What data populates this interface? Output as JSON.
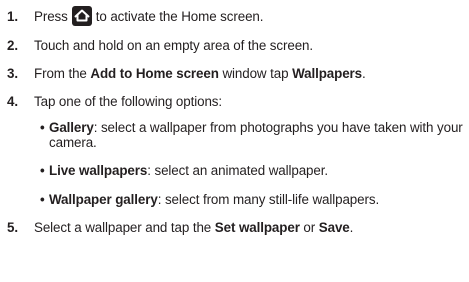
{
  "steps": [
    {
      "number": "1.",
      "before": "Press",
      "icon": "home-key-icon",
      "after": "to activate the Home screen."
    },
    {
      "number": "2.",
      "text": "Touch and hold on an empty area of the screen."
    },
    {
      "number": "3.",
      "pre": "From the ",
      "b1": "Add to Home screen",
      "mid": " window tap ",
      "b2": "Wallpapers",
      "end": "."
    },
    {
      "number": "4.",
      "text": "Tap one of the following options:"
    },
    {
      "number": "5.",
      "pre": "Select a wallpaper and tap the ",
      "b1": "Set wallpaper",
      "mid": " or ",
      "b2": "Save",
      "end": "."
    }
  ],
  "options": [
    {
      "name": "Gallery",
      "desc": ": select a wallpaper from photographs you have taken with your camera."
    },
    {
      "name": "Live wallpapers",
      "desc": ": select an animated wallpaper."
    },
    {
      "name": "Wallpaper gallery",
      "desc": ": select from many still-life wallpapers."
    }
  ],
  "bullet_char": "•"
}
